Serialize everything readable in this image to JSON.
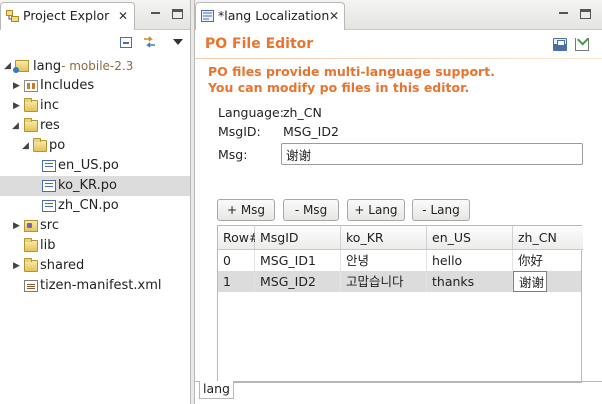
{
  "explorer": {
    "tab_title": "Project Explor",
    "close_glyph": "✕",
    "toolbar": {
      "collapse_icon": "collapse-all-icon",
      "link_icon": "link-with-editor-icon",
      "menu_icon": "view-menu-icon"
    },
    "items": [
      {
        "label": "lang",
        "decoration": "- mobile-2.3",
        "icon": "project-icon",
        "expanded": true
      },
      {
        "label": "Includes",
        "icon": "includes-icon",
        "expanded": false
      },
      {
        "label": "inc",
        "icon": "folder-icon",
        "expanded": false
      },
      {
        "label": "res",
        "icon": "folder-icon",
        "expanded": true
      },
      {
        "label": "po",
        "icon": "folder-icon",
        "expanded": true
      },
      {
        "label": "en_US.po",
        "icon": "po-file-icon"
      },
      {
        "label": "ko_KR.po",
        "icon": "po-file-icon",
        "selected": true
      },
      {
        "label": "zh_CN.po",
        "icon": "po-file-icon"
      },
      {
        "label": "src",
        "icon": "source-folder-icon",
        "expanded": false
      },
      {
        "label": "lib",
        "icon": "folder-icon"
      },
      {
        "label": "shared",
        "icon": "folder-icon",
        "expanded": false
      },
      {
        "label": "tizen-manifest.xml",
        "icon": "xml-file-icon"
      }
    ]
  },
  "editor": {
    "tab_title": "*lang Localization",
    "close_glyph": "✕",
    "form_title": "PO File Editor",
    "desc_line1": "PO files provide multi-language support.",
    "desc_line2": "You can modify po files in this editor.",
    "language_label": "Language:",
    "language_value": "zh_CN",
    "msgid_label": "MsgID:",
    "msgid_value": "MSG_ID2",
    "msg_label": "Msg:",
    "msg_value": "谢谢",
    "buttons": {
      "add_msg": "+ Msg",
      "remove_msg": "- Msg",
      "add_lang": "+ Lang",
      "remove_lang": "- Lang"
    },
    "table": {
      "columns": [
        "Row#",
        "MsgID",
        "ko_KR",
        "en_US",
        "zh_CN"
      ],
      "rows": [
        [
          "0",
          "MSG_ID1",
          "안녕",
          "hello",
          "你好"
        ],
        [
          "1",
          "MSG_ID2",
          "고맙습니다",
          "thanks",
          "谢谢"
        ]
      ],
      "selected_row": 1
    },
    "bottom_tab": "lang"
  },
  "colors": {
    "accent": "#e8742f",
    "selection": "#dcdcdc"
  }
}
